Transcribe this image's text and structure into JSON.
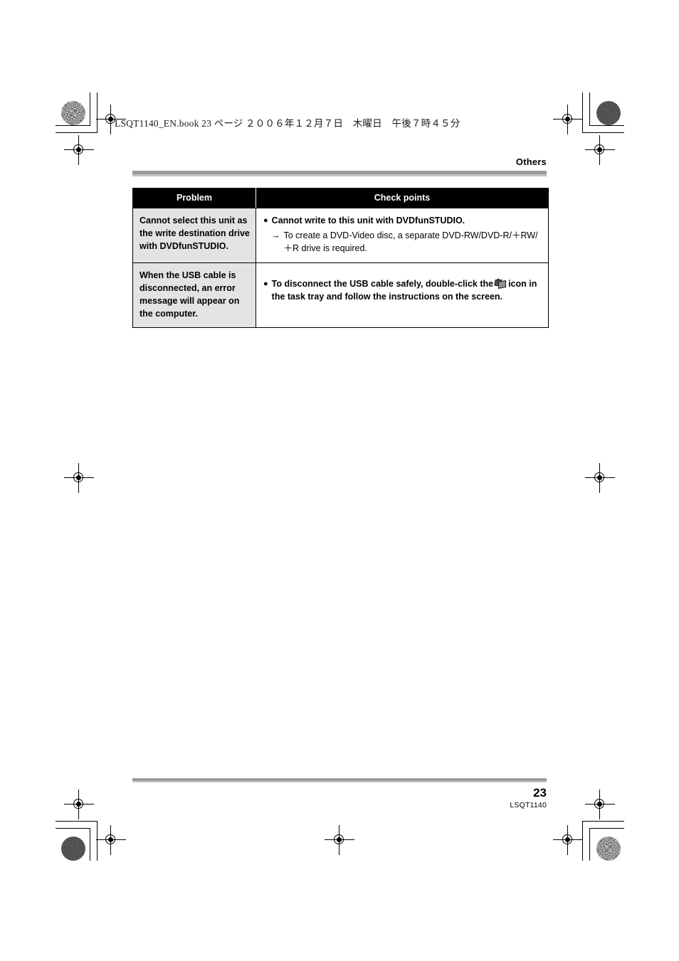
{
  "book_header": "LSQT1140_EN.book  23 ページ  ２００６年１２月７日　木曜日　午後７時４５分",
  "running_head": "Others",
  "table": {
    "headers": {
      "problem": "Problem",
      "check_points": "Check points"
    },
    "rows": [
      {
        "problem": "Cannot select this unit as the write destination drive with DVDfunSTUDIO.",
        "bullet_glyph": "●",
        "check_main": "Cannot write to this unit with DVDfunSTUDIO.",
        "sub_arrow": "→",
        "check_sub": "To create a DVD-Video disc, a separate DVD-RW/DVD-R/＋RW/＋R drive is required.",
        "has_icon": false
      },
      {
        "problem": "When the USB cable is disconnected, an error message will appear on the computer.",
        "bullet_glyph": "●",
        "check_text_before_icon": "To disconnect the USB cable safely, double-click the",
        "icon_name": "safely-remove-hardware-icon",
        "check_text_after_icon": "icon in the task tray and follow the instructions on the screen.",
        "has_icon": true
      }
    ]
  },
  "footer": {
    "page_number": "23",
    "doc_code": "LSQT1140"
  },
  "colors": {
    "header_bar": "#000000",
    "problem_cell_bg": "#e3e3e3",
    "rule_dark": "#9a9a9a",
    "rule_light": "#c4c4c4"
  }
}
